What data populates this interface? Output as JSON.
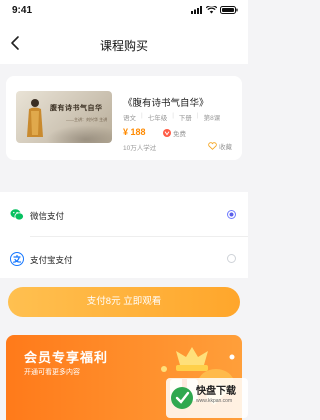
{
  "status_bar": {
    "time": "9:41"
  },
  "header": {
    "title": "课程购买"
  },
  "course": {
    "cover_title": "腹有诗书气自华",
    "cover_subtitle": "——主讲：刘兴华 主讲",
    "name": "《腹有诗书气自华》",
    "meta": [
      "语文",
      "七年级",
      "下册",
      "第8课"
    ],
    "price": "¥ 188",
    "free_label": "免费",
    "learners": "10万人学过",
    "favorite_label": "收藏"
  },
  "payment": {
    "methods": [
      {
        "label": "微信支付",
        "selected": true
      },
      {
        "label": "支付宝支付",
        "selected": false
      }
    ],
    "pay_button": "支付8元 立即观看"
  },
  "vip_banner": {
    "title": "会员专享福利",
    "subtitle": "开通可看更多内容"
  },
  "watermark": {
    "brand": "快盘下载",
    "url": "www.kkpan.com"
  },
  "colors": {
    "accent": "#ffa62b",
    "price": "#ff8a00",
    "radio": "#5b5fe8",
    "wechat": "#07c160",
    "alipay": "#1677ff"
  }
}
